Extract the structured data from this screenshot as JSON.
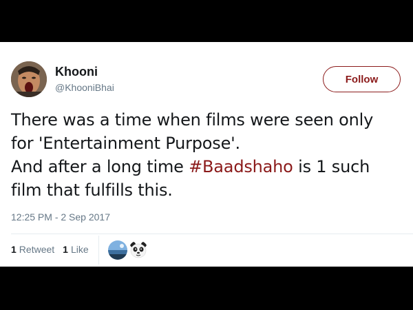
{
  "user": {
    "name": "Khooni",
    "handle": "@KhooniBhai"
  },
  "follow_label": "Follow",
  "tweet": {
    "line1": "There was a time when films were seen only",
    "line2": "for 'Entertainment Purpose'.",
    "line3_prefix": "And after a long time ",
    "hashtag": "#Baadshaho",
    "line3_suffix": " is 1 such",
    "line4": "film that fulfills this."
  },
  "timestamp": "12:25 PM - 2 Sep 2017",
  "stats": {
    "retweet_count": "1",
    "retweet_label": "Retweet",
    "like_count": "1",
    "like_label": "Like"
  },
  "colors": {
    "accent": "#8b1a1a",
    "muted": "#657786",
    "text": "#14171a"
  }
}
